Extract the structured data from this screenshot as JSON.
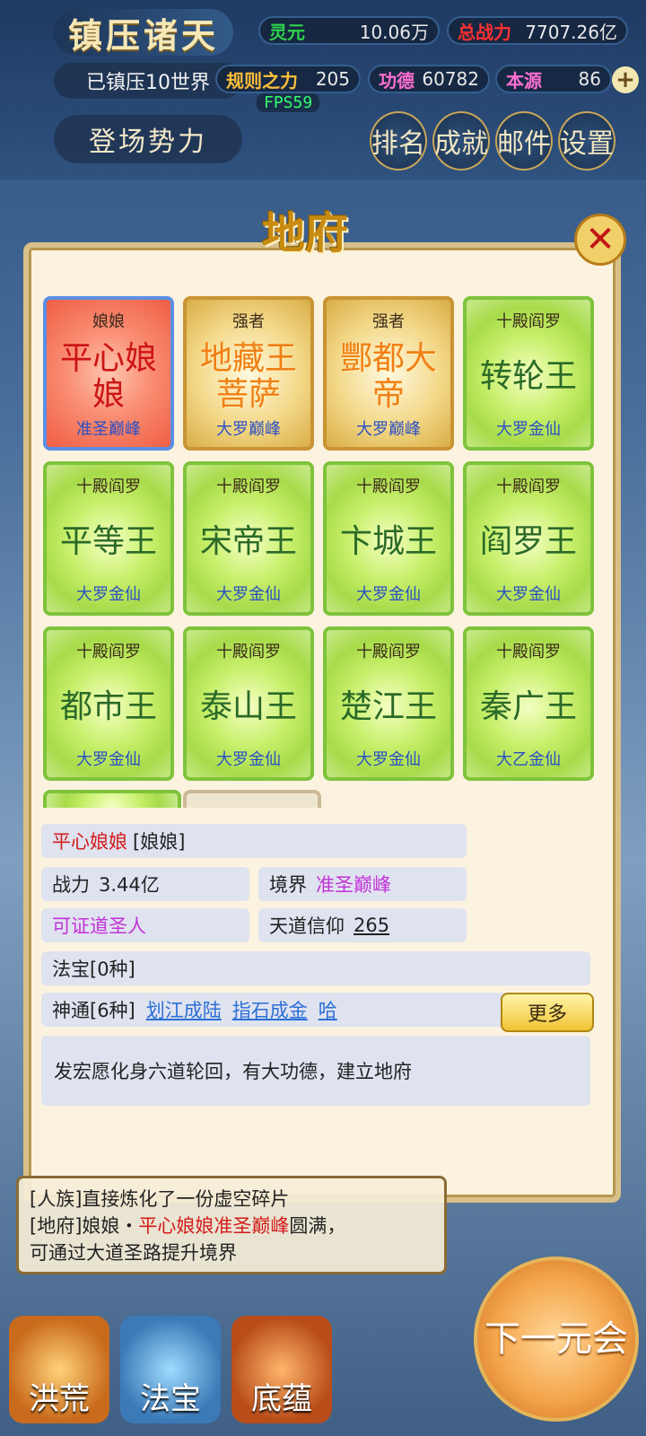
{
  "hud": {
    "title": "镇压诸天",
    "subtitle": "已镇压10世界",
    "forces": "登场势力",
    "fps": "FPS59",
    "plus": "+",
    "stats": [
      {
        "label": "灵元",
        "value": "10.06万",
        "color": "#2fd34a"
      },
      {
        "label": "总战力",
        "value": "7707.26亿",
        "color": "#ff3030"
      },
      {
        "label": "规则之力",
        "value": "205",
        "color": "#ffbf3a"
      },
      {
        "label": "功德",
        "value": "60782",
        "color": "#ff6fd1"
      },
      {
        "label": "本源",
        "value": "86",
        "color": "#ff6fd1"
      }
    ],
    "menu": [
      "排名",
      "成就",
      "邮件",
      "设置"
    ]
  },
  "modal": {
    "title": "地府",
    "close": "✕",
    "cards": [
      {
        "top": "娘娘",
        "name": "平心娘娘",
        "realm": "准圣巅峰",
        "style": "red"
      },
      {
        "top": "强者",
        "name": "地藏王菩萨",
        "realm": "大罗巅峰",
        "style": "gold"
      },
      {
        "top": "强者",
        "name": "酆都大帝",
        "realm": "大罗巅峰",
        "style": "gold"
      },
      {
        "top": "十殿阎罗",
        "name": "转轮王",
        "realm": "大罗金仙",
        "style": "green"
      },
      {
        "top": "十殿阎罗",
        "name": "平等王",
        "realm": "大罗金仙",
        "style": "green"
      },
      {
        "top": "十殿阎罗",
        "name": "宋帝王",
        "realm": "大罗金仙",
        "style": "green"
      },
      {
        "top": "十殿阎罗",
        "name": "卞城王",
        "realm": "大罗金仙",
        "style": "green"
      },
      {
        "top": "十殿阎罗",
        "name": "阎罗王",
        "realm": "大罗金仙",
        "style": "green"
      },
      {
        "top": "十殿阎罗",
        "name": "都市王",
        "realm": "大罗金仙",
        "style": "green"
      },
      {
        "top": "十殿阎罗",
        "name": "泰山王",
        "realm": "大罗金仙",
        "style": "green"
      },
      {
        "top": "十殿阎罗",
        "name": "楚江王",
        "realm": "大罗金仙",
        "style": "green"
      },
      {
        "top": "十殿阎罗",
        "name": "秦广王",
        "realm": "大乙金仙",
        "style": "green"
      }
    ]
  },
  "detail": {
    "name": "平心娘娘",
    "tag": "[娘娘]",
    "power_label": "战力",
    "power_value": "3.44亿",
    "realm_label": "境界",
    "realm_value": "准圣巅峰",
    "sage": "可证道圣人",
    "faith_label": "天道信仰",
    "faith_value": "265",
    "treasure": "法宝[0种]",
    "skills_label": "神通[6种]",
    "skills": [
      "划江成陆",
      "指石成金",
      "哈"
    ],
    "more": "更多",
    "description": "发宏愿化身六道轮回，有大功德，建立地府"
  },
  "log": {
    "line1": "[人族]直接炼化了一份虚空碎片",
    "line2_prefix": "[地府]娘娘・",
    "line2_name": "平心娘娘准圣巅峰",
    "line2_suffix": "圆满，",
    "line3": "可通过大道圣路提升境界"
  },
  "nav": {
    "next_era": "下一元会",
    "buttons": [
      "洪荒",
      "法宝",
      "底蕴"
    ]
  }
}
